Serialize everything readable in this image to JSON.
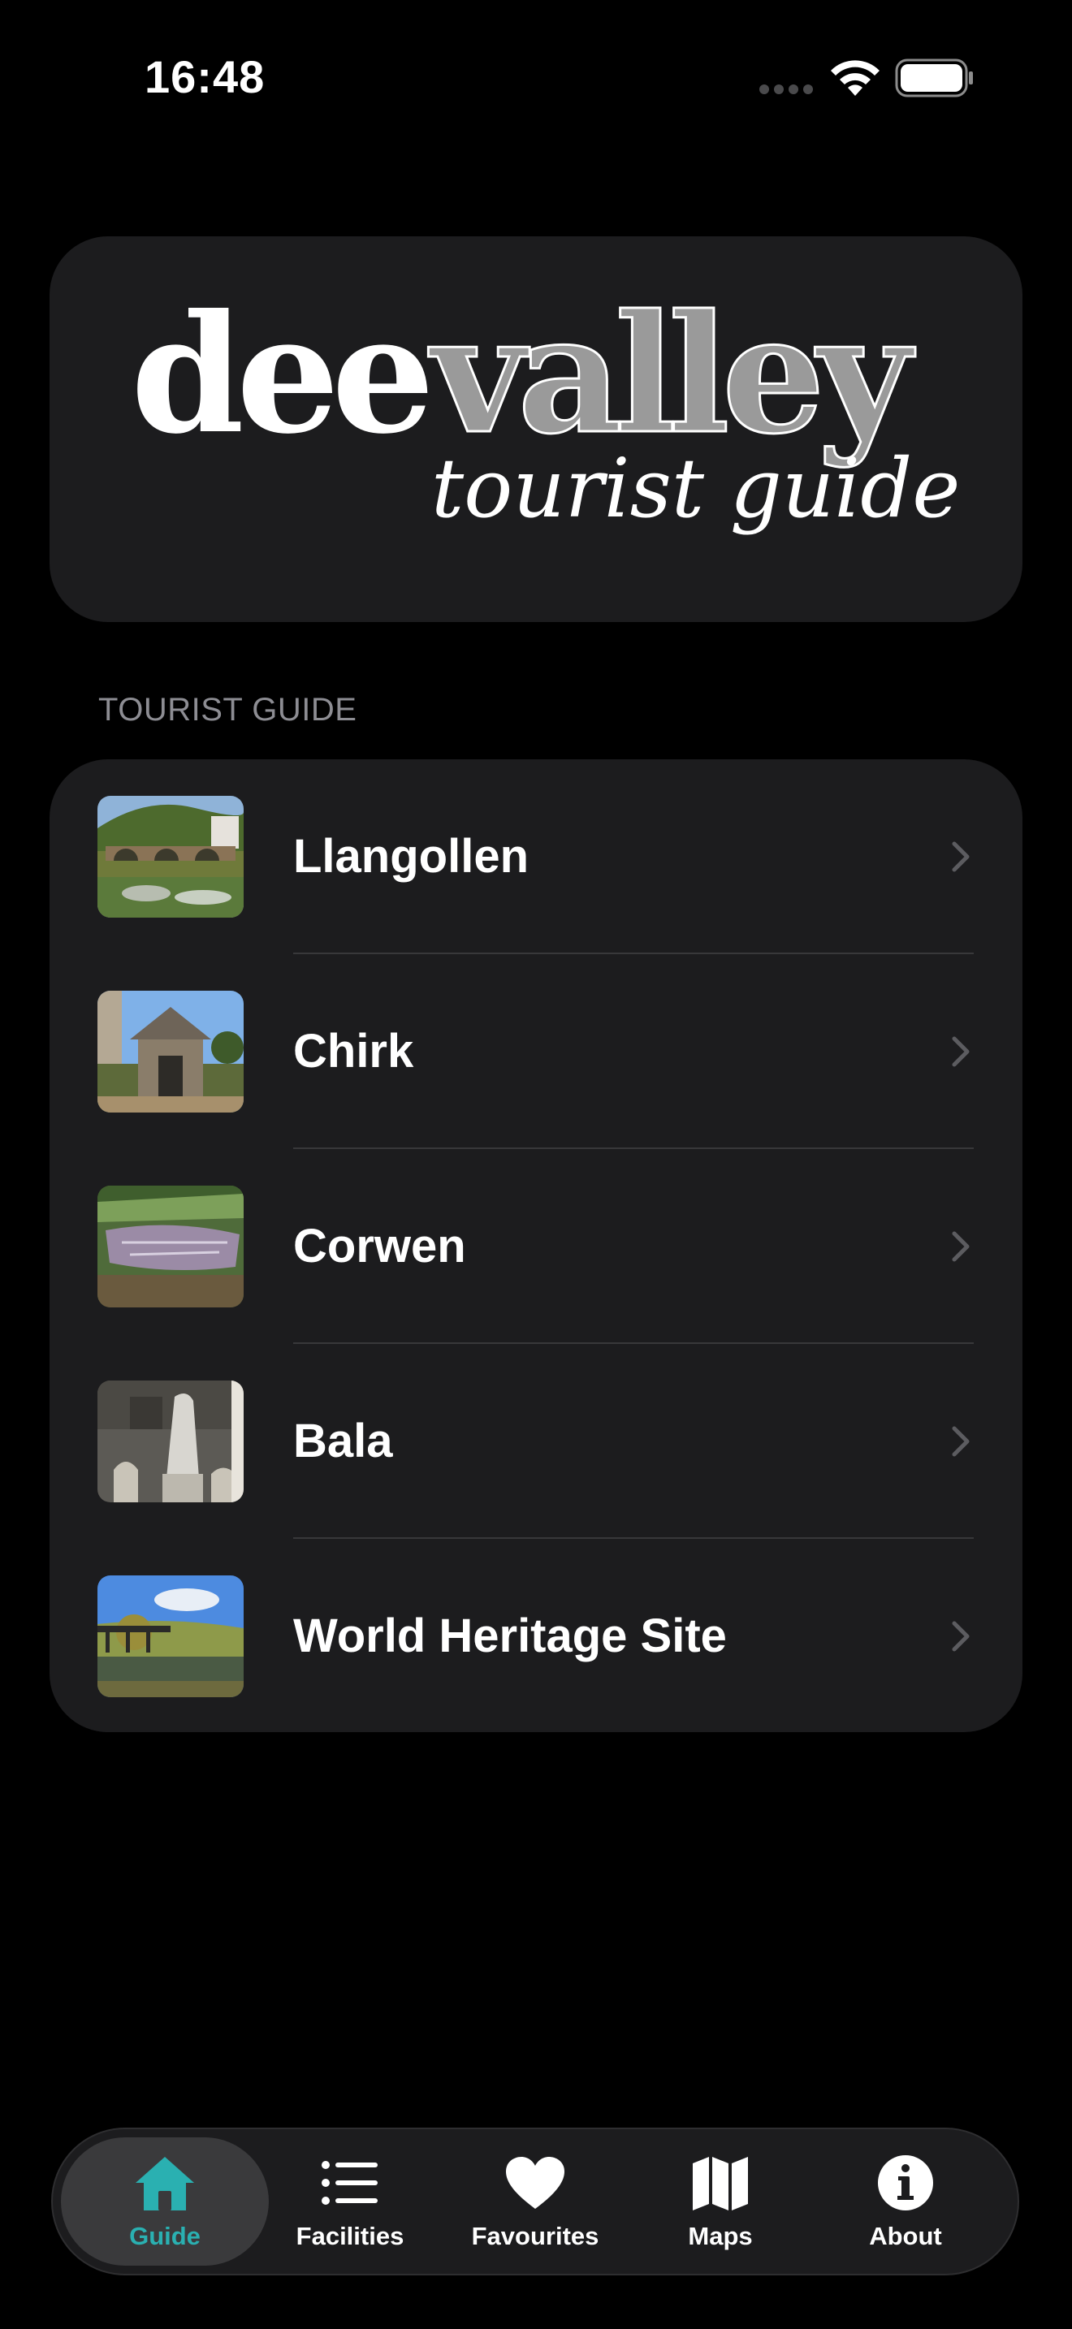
{
  "status_bar": {
    "time": "16:48"
  },
  "logo": {
    "word_dee": "dee",
    "word_valley": "valley",
    "tagline": "tourist guide"
  },
  "section": {
    "header": "TOURIST GUIDE"
  },
  "guide_items": [
    {
      "label": "Llangollen",
      "thumb": "bridge-river-photo"
    },
    {
      "label": "Chirk",
      "thumb": "church-lychgate-photo"
    },
    {
      "label": "Corwen",
      "thumb": "town-aerial-photo"
    },
    {
      "label": "Bala",
      "thumb": "statue-photo"
    },
    {
      "label": "World Heritage Site",
      "thumb": "aqueduct-photo"
    }
  ],
  "tabs": [
    {
      "label": "Guide",
      "icon": "house-icon",
      "selected": true
    },
    {
      "label": "Facilities",
      "icon": "list-icon",
      "selected": false
    },
    {
      "label": "Favourites",
      "icon": "heart-icon",
      "selected": false
    },
    {
      "label": "Maps",
      "icon": "map-icon",
      "selected": false
    },
    {
      "label": "About",
      "icon": "info-icon",
      "selected": false
    }
  ],
  "colors": {
    "accent": "#2ab0b1",
    "background": "#000000",
    "card": "#1c1c1e",
    "section_header": "#8d8d93"
  }
}
